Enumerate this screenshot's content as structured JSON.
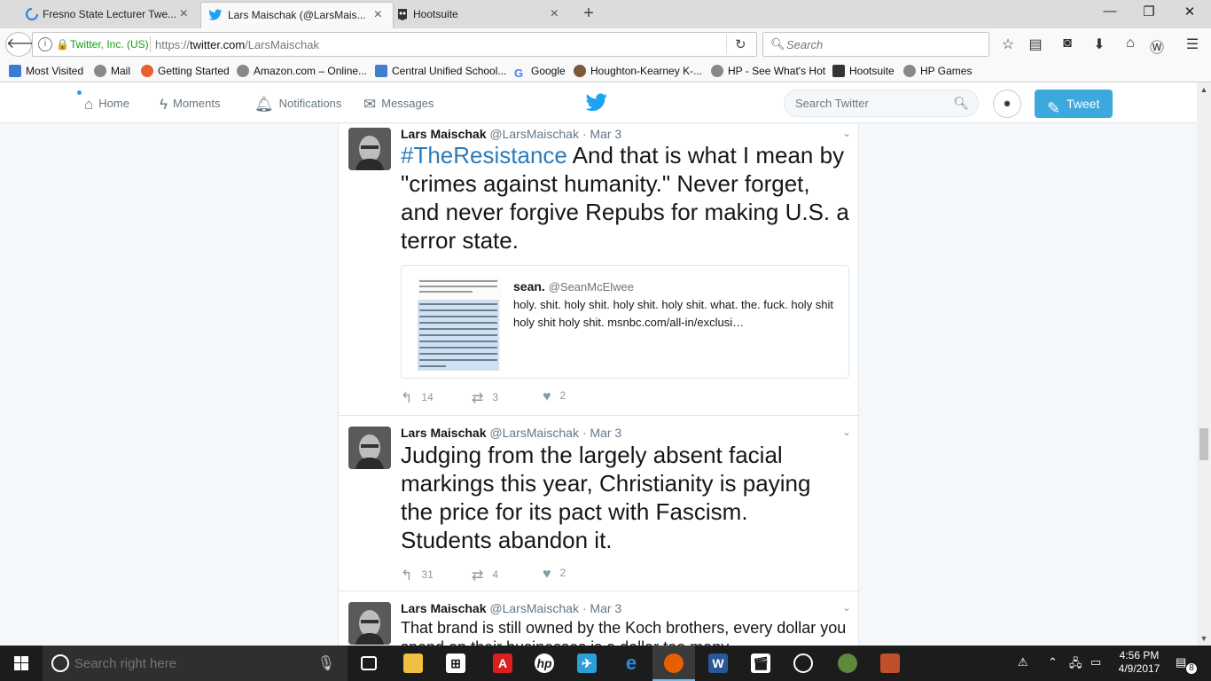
{
  "browser": {
    "tabs": [
      {
        "title": "Fresno State Lecturer Twe...",
        "icon": "loading-spinner-icon"
      },
      {
        "title": "Lars Maischak (@LarsMais...",
        "icon": "twitter-bird-icon"
      },
      {
        "title": "Hootsuite",
        "icon": "hootsuite-icon"
      }
    ],
    "new_tab": "+",
    "window_controls": {
      "minimize": "—",
      "restore": "❐",
      "close": "✕"
    },
    "identity": "Twitter, Inc. (US)",
    "url_scheme": "https://",
    "url_host": "twitter.com",
    "url_path": "/LarsMaischak",
    "search_placeholder": "Search",
    "bookmarks": [
      "Most Visited",
      "Mail",
      "Getting Started",
      "Amazon.com – Online...",
      "Central Unified School...",
      "Google",
      "Houghton-Kearney K-...",
      "HP - See What's Hot",
      "Hootsuite",
      "HP Games"
    ]
  },
  "twitter": {
    "nav": {
      "home": "Home",
      "moments": "Moments",
      "notifications": "Notifications",
      "messages": "Messages",
      "search_placeholder": "Search Twitter",
      "tweet_button": "Tweet"
    },
    "tweets": [
      {
        "name": "Lars Maischak",
        "handle": "@LarsMaischak",
        "sep": "·",
        "date": "Mar 3",
        "hashtag": "#TheResistance",
        "text": " And that is what I mean by \"crimes against humanity.\"  Never forget, and never forgive Repubs for making U.S. a terror state.",
        "quoted": {
          "name": "sean.",
          "handle": "@SeanMcElwee",
          "text": "holy. shit. holy shit. holy shit. holy shit. what. the. fuck. holy shit holy shit holy shit. msnbc.com/all-in/exclusi…"
        },
        "replies": "14",
        "retweets": "3",
        "likes": "2"
      },
      {
        "name": "Lars Maischak",
        "handle": "@LarsMaischak",
        "sep": "·",
        "date": "Mar 3",
        "text": "Judging from the largely absent facial markings this year, Christianity is paying the price for its pact with Fascism. Students abandon it.",
        "replies": "31",
        "retweets": "4",
        "likes": "2"
      },
      {
        "name": "Lars Maischak",
        "handle": "@LarsMaischak",
        "sep": "·",
        "date": "Mar 3",
        "text": "That brand is still owned by the Koch brothers, every dollar you spend on their businesses is a dollar too many."
      }
    ]
  },
  "taskbar": {
    "search_placeholder": "Search right here",
    "time": "4:56 PM",
    "date": "4/9/2017",
    "notification_count": "8"
  },
  "colors": {
    "twitter_blue": "#1da1f2",
    "hashtag": "#2b7bb9",
    "tweet_button": "#3ba9dd",
    "taskbar": "#1c1c1c"
  }
}
